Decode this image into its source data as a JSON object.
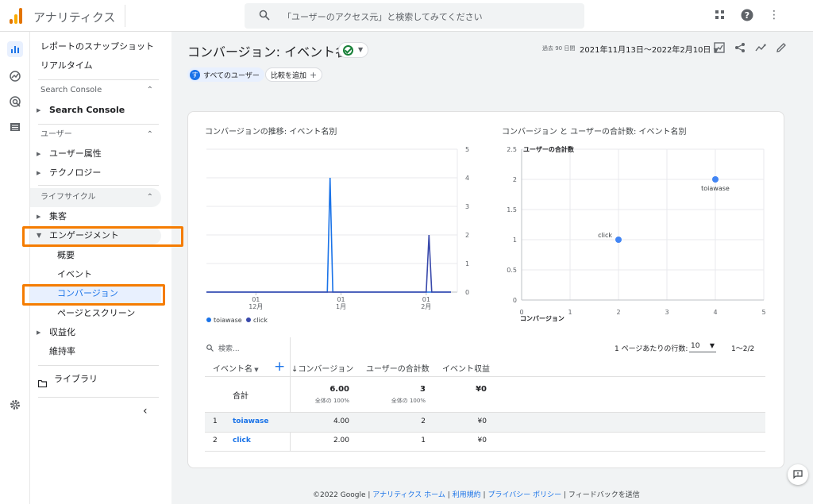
{
  "app": {
    "title": "アナリティクス"
  },
  "search": {
    "placeholder": "「ユーザーのアクセス元」と検索してみてください"
  },
  "sidebar": {
    "snapshot": "レポートのスナップショット",
    "realtime": "リアルタイム",
    "sc_section": "Search Console",
    "sc_item": "Search Console",
    "user_section": "ユーザー",
    "user_attr": "ユーザー属性",
    "technology": "テクノロジー",
    "lifecycle_section": "ライフサイクル",
    "acquisition": "集客",
    "engagement": "エンゲージメント",
    "overview": "概要",
    "events": "イベント",
    "conversions": "コンバージョン",
    "pages": "ページとスクリーン",
    "monetization": "収益化",
    "retention": "維持率",
    "library": "ライブラリ"
  },
  "header": {
    "title": "コンバージョン: イベント名",
    "date_label": "過去 90 日間",
    "date_range": "2021年11月13日～2022年2月10日",
    "chip_users": "すべてのユーザー",
    "chip_avatar": "す",
    "chip_compare": "比較を追加"
  },
  "line_chart": {
    "title": "コンバージョンの推移: イベント名別",
    "yticks": [
      "5",
      "4",
      "3",
      "2",
      "1",
      "0"
    ],
    "xticks": [
      {
        "day": "01",
        "month": "12月"
      },
      {
        "day": "01",
        "month": "1月"
      },
      {
        "day": "01",
        "month": "2月"
      }
    ],
    "legend": [
      "toiawase",
      "click"
    ]
  },
  "scatter_chart": {
    "title": "コンバージョン と ユーザーの合計数: イベント名別",
    "ylabel": "ユーザーの合計数",
    "xlabel": "コンバージョン",
    "yticks": [
      "2.5",
      "2",
      "1.5",
      "1",
      "0.5",
      "0"
    ],
    "xticks": [
      "0",
      "1",
      "2",
      "3",
      "4",
      "5"
    ]
  },
  "chart_data": [
    {
      "type": "line",
      "title": "コンバージョンの推移: イベント名別",
      "xlabel": "",
      "ylabel": "",
      "ylim": [
        0,
        5
      ],
      "x": [
        "2021-11-13",
        "2021-12-27",
        "2021-12-28",
        "2021-12-29",
        "2022-02-01",
        "2022-02-02",
        "2022-02-03",
        "2022-02-10"
      ],
      "series": [
        {
          "name": "toiawase",
          "color": "#1a73e8",
          "values": [
            0,
            0,
            4,
            0,
            0,
            0,
            0,
            0
          ]
        },
        {
          "name": "click",
          "color": "#3949ab",
          "values": [
            0,
            0,
            0,
            0,
            0,
            2,
            0,
            0
          ]
        }
      ],
      "grid": true,
      "legend": "bottom-left"
    },
    {
      "type": "scatter",
      "title": "コンバージョン と ユーザーの合計数: イベント名別",
      "xlabel": "コンバージョン",
      "ylabel": "ユーザーの合計数",
      "xlim": [
        0,
        5
      ],
      "ylim": [
        0,
        2.5
      ],
      "points": [
        {
          "label": "toiawase",
          "x": 4,
          "y": 2
        },
        {
          "label": "click",
          "x": 2,
          "y": 1
        }
      ],
      "grid": true
    }
  ],
  "table": {
    "search_placeholder": "検索...",
    "rows_per_page_label": "1 ページあたりの行数:",
    "rows_per_page": "10",
    "pager": "1～2/2",
    "headers": {
      "dimension": "イベント名",
      "conversions": "コンバージョン",
      "users": "ユーザーの合計数",
      "revenue": "イベント収益"
    },
    "total": {
      "label": "合計",
      "conversions": "6.00",
      "conversions_sub": "全体の 100%",
      "users": "3",
      "users_sub": "全体の 100%",
      "revenue": "¥0"
    },
    "rows": [
      {
        "idx": "1",
        "name": "toiawase",
        "conversions": "4.00",
        "users": "2",
        "revenue": "¥0"
      },
      {
        "idx": "2",
        "name": "click",
        "conversions": "2.00",
        "users": "1",
        "revenue": "¥0"
      }
    ]
  },
  "footer": {
    "copyright": "©2022 Google",
    "home": "アナリティクス ホーム",
    "terms": "利用規約",
    "privacy": "プライバシー ポリシー",
    "feedback": "フィードバックを送信"
  },
  "colors": {
    "accent": "#1a73e8",
    "highlight": "#f57c00",
    "series2": "#3949ab"
  }
}
